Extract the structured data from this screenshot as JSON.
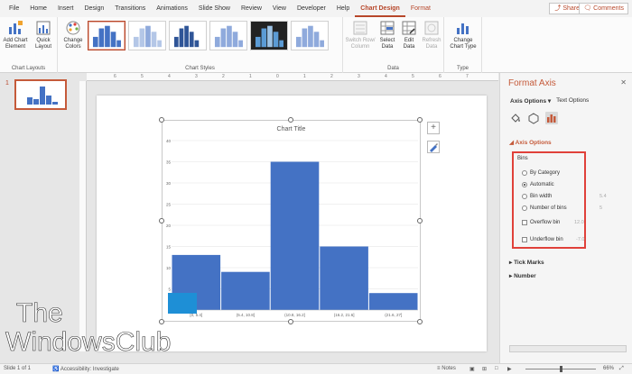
{
  "ribbon_tabs": [
    "File",
    "Home",
    "Insert",
    "Design",
    "Transitions",
    "Animations",
    "Slide Show",
    "Review",
    "View",
    "Developer",
    "Help",
    "Chart Design",
    "Format"
  ],
  "active_tab": "Chart Design",
  "share_label": "Share",
  "comments_label": "Comments",
  "groups": {
    "chart_layouts": {
      "label": "Chart Layouts",
      "add_chart_element": "Add Chart Element",
      "quick_layout": "Quick Layout"
    },
    "chart_styles": {
      "label": "Chart Styles",
      "change_colors": "Change Colors"
    },
    "data": {
      "label": "Data",
      "switch_row_column": "Switch Row/ Column",
      "select_data": "Select Data",
      "edit_data": "Edit Data",
      "refresh_data": "Refresh Data"
    },
    "type": {
      "label": "Type",
      "change_chart_type": "Change Chart Type"
    }
  },
  "slide_number": "1",
  "chart_title": "Chart Title",
  "chart_data": {
    "type": "bar",
    "title": "Chart Title",
    "categories": [
      "[0, 5.4]",
      "(5.4, 10.8]",
      "(10.8, 16.2]",
      "(16.2, 21.6]",
      "(21.6, 27]"
    ],
    "values": [
      13,
      9,
      35,
      15,
      4
    ],
    "yticks": [
      0,
      5,
      10,
      15,
      20,
      25,
      30,
      35,
      40
    ],
    "ylim": [
      0,
      40
    ],
    "color": "#4472c4",
    "grid": true
  },
  "format_pane": {
    "title": "Format Axis",
    "tab_axis_options": "Axis Options",
    "tab_text_options": "Text Options",
    "section_axis_options": "Axis Options",
    "bins_label": "Bins",
    "opt_by_category": "By Category",
    "opt_automatic": "Automatic",
    "opt_bin_width": "Bin width",
    "opt_number_of_bins": "Number of bins",
    "opt_overflow_bin": "Overflow bin",
    "opt_underflow_bin": "Underflow bin",
    "bin_width_value": "5.4",
    "number_of_bins_value": "5",
    "overflow_value": "12.0",
    "underflow_value": "-7.0",
    "section_tick_marks": "Tick Marks",
    "section_number": "Number"
  },
  "status": {
    "slide_info": "Slide 1 of 1",
    "accessibility": "Accessibility: Investigate",
    "notes": "Notes",
    "zoom": "66%"
  },
  "watermark": {
    "line1": "The",
    "line2": "WindowsClub"
  },
  "colors": {
    "accent": "#b7472a",
    "bar": "#4472c4",
    "highlight_box": "#e0413a"
  }
}
